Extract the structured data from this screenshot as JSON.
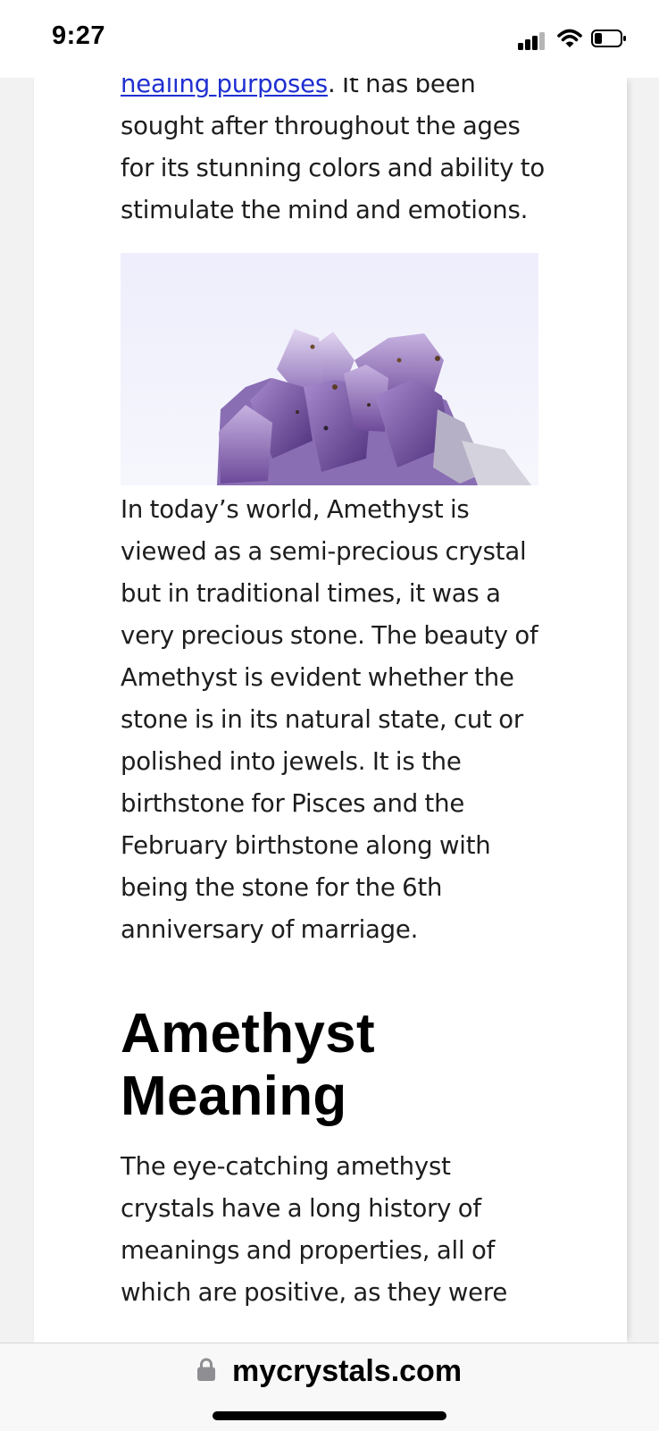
{
  "status_bar": {
    "time": "9:27"
  },
  "article": {
    "para1_link": "healing purposes",
    "para1_rest": ". It has been sought after throughout the ages for its stunning colors and ability to stimulate the mind and emotions.",
    "para2": "In today’s world, Amethyst is viewed as a semi-precious crystal but in traditional times, it was a very precious stone. The beauty of Amethyst is evident whether the stone is in its natural state, cut or polished into jewels. It is the birthstone for Pisces and the February birthstone along with being the stone for the 6th anniversary of marriage.",
    "heading": "Amethyst Meaning",
    "para3": "The eye-catching amethyst crystals have a long history of meanings and properties, all of which are positive, as they were"
  },
  "browser": {
    "url": "mycrystals.com"
  },
  "colors": {
    "link": "#1f2fd1",
    "text": "#1d1d1d",
    "crystal": "#7a5aa6"
  },
  "icons": [
    "signal-icon",
    "wifi-icon",
    "battery-icon",
    "lock-icon",
    "crystal-image"
  ]
}
